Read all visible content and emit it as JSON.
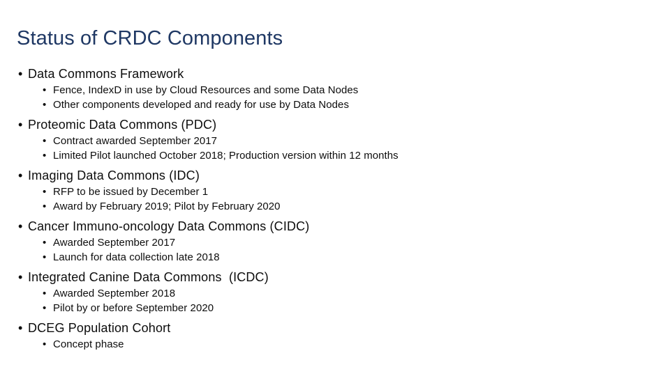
{
  "slide": {
    "title": "Status of CRDC Components",
    "title_color": "#1F3864",
    "body_color": "#0D0D0D",
    "background_color": "#FFFFFF",
    "bullet_glyph_level1": "•",
    "bullet_glyph_level2": "•",
    "sections": [
      {
        "heading": "Data Commons Framework",
        "items": [
          "Fence, IndexD in use by Cloud Resources and some Data Nodes",
          "Other components developed and ready for use by Data Nodes"
        ]
      },
      {
        "heading": "Proteomic Data Commons (PDC)",
        "items": [
          "Contract awarded September 2017",
          "Limited Pilot launched October 2018; Production version within 12 months"
        ]
      },
      {
        "heading": "Imaging Data Commons (IDC)",
        "items": [
          "RFP to be issued by December 1",
          "Award by February 2019; Pilot by February 2020"
        ]
      },
      {
        "heading": "Cancer Immuno-oncology Data Commons (CIDC)",
        "items": [
          "Awarded September 2017",
          "Launch for data collection late 2018"
        ]
      },
      {
        "heading": "Integrated Canine Data Commons  (ICDC)",
        "items": [
          "Awarded September 2018",
          "Pilot by or before September 2020"
        ]
      },
      {
        "heading": "DCEG Population Cohort",
        "items": [
          "Concept phase"
        ]
      }
    ]
  }
}
